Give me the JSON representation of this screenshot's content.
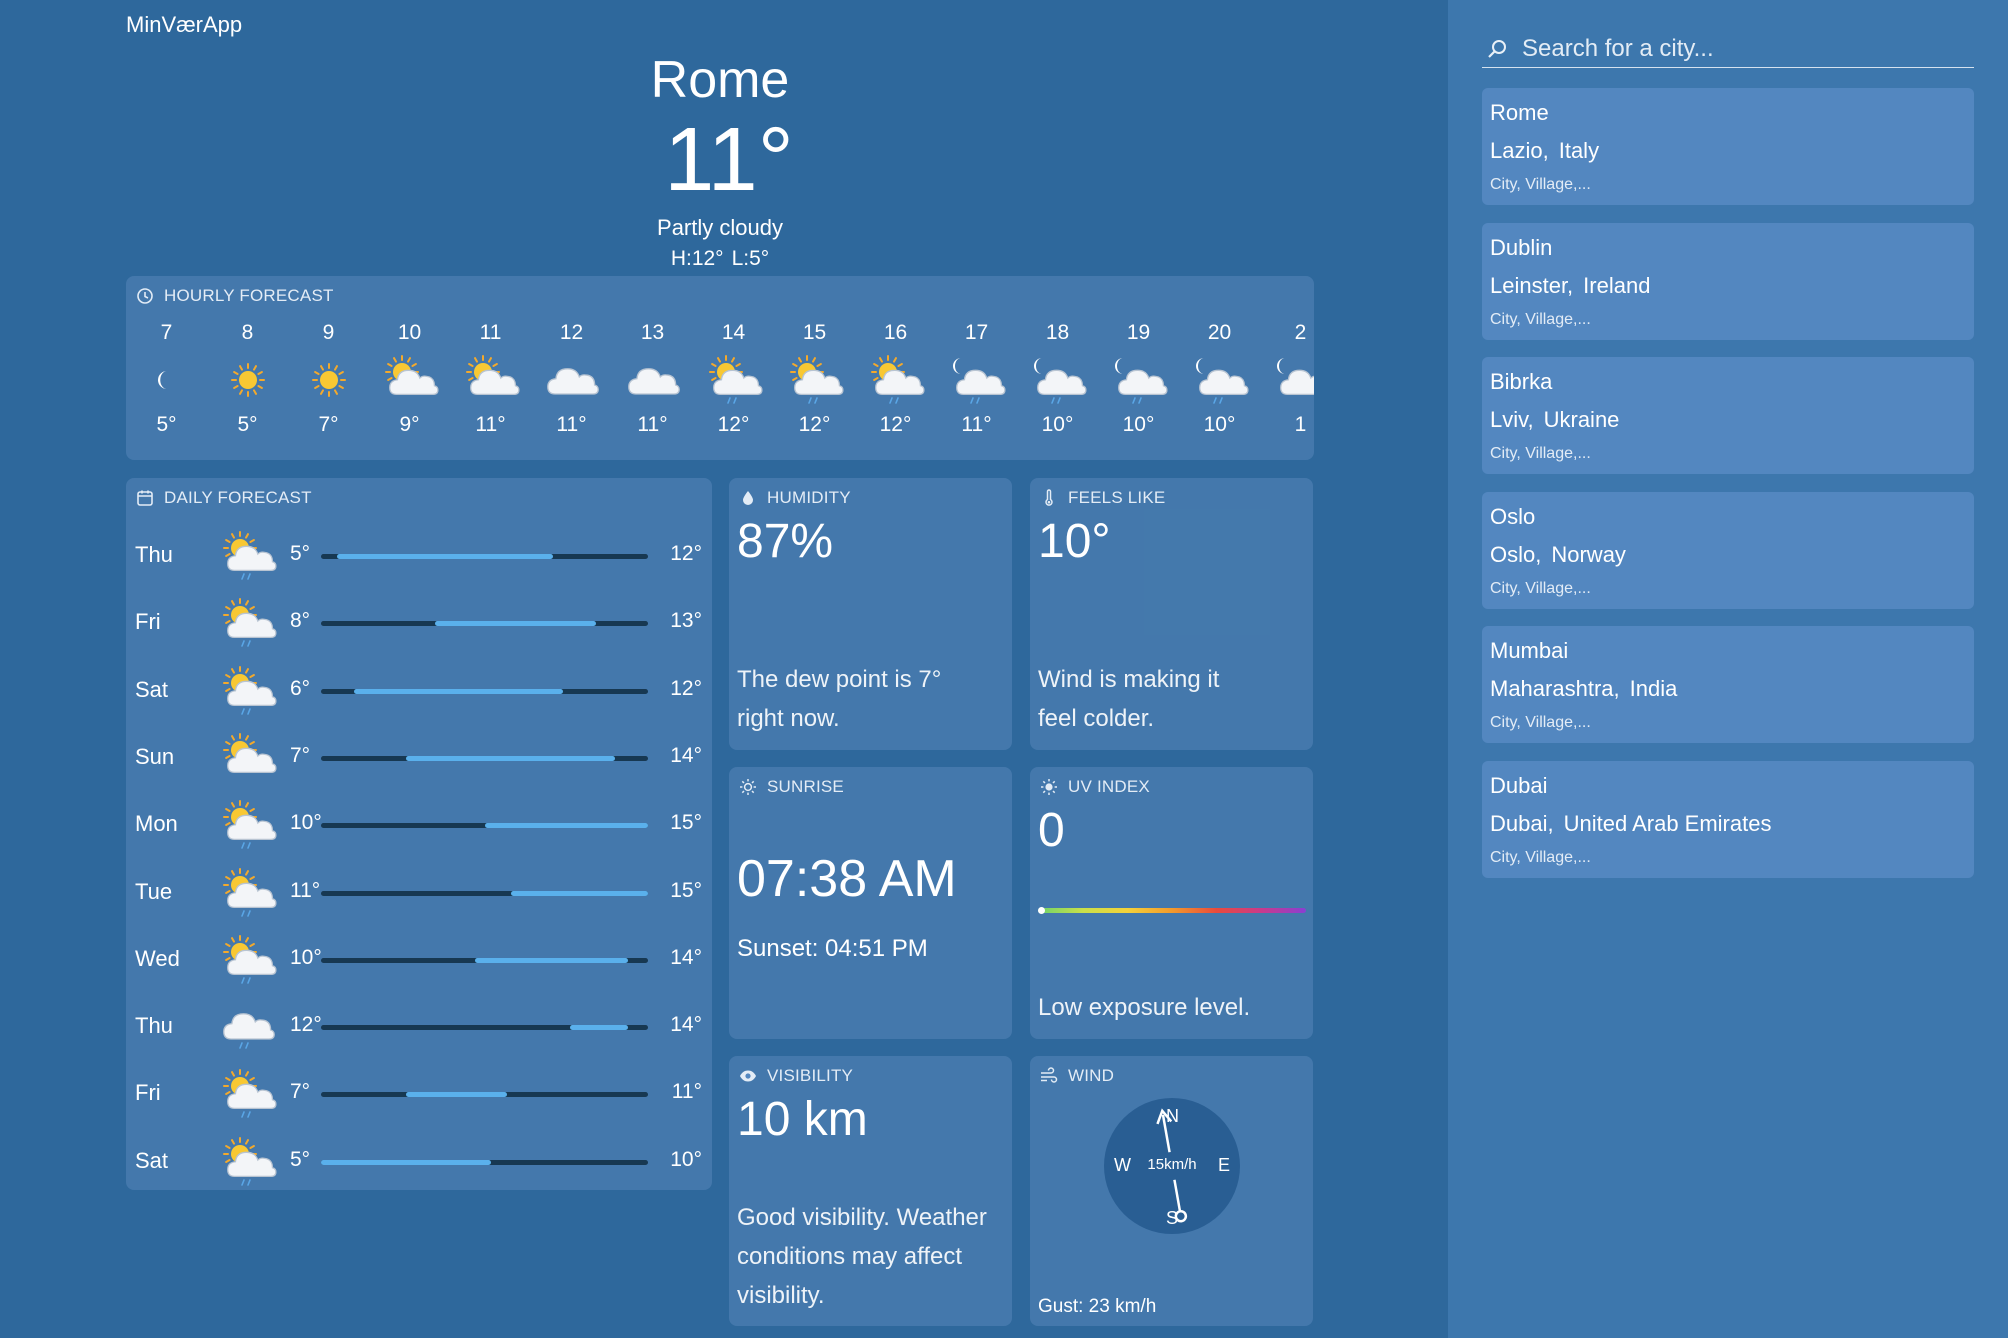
{
  "app": {
    "title": "MinVærApp"
  },
  "current": {
    "city": "Rome",
    "temp": "11°",
    "condition": "Partly cloudy",
    "high": "H:12°",
    "low": "L:5°"
  },
  "hourly": {
    "header": "HOURLY FORECAST",
    "icon": "clock-icon",
    "items": [
      {
        "hour": "7",
        "temp": "5°",
        "icon": "moon"
      },
      {
        "hour": "8",
        "temp": "5°",
        "icon": "sun"
      },
      {
        "hour": "9",
        "temp": "7°",
        "icon": "sun"
      },
      {
        "hour": "10",
        "temp": "9°",
        "icon": "sun-cloud"
      },
      {
        "hour": "11",
        "temp": "11°",
        "icon": "sun-cloud"
      },
      {
        "hour": "12",
        "temp": "11°",
        "icon": "cloud"
      },
      {
        "hour": "13",
        "temp": "11°",
        "icon": "cloud"
      },
      {
        "hour": "14",
        "temp": "12°",
        "icon": "sun-cloud-rain"
      },
      {
        "hour": "15",
        "temp": "12°",
        "icon": "sun-cloud-rain"
      },
      {
        "hour": "16",
        "temp": "12°",
        "icon": "sun-cloud-rain"
      },
      {
        "hour": "17",
        "temp": "11°",
        "icon": "moon-cloud-rain"
      },
      {
        "hour": "18",
        "temp": "10°",
        "icon": "moon-cloud-rain"
      },
      {
        "hour": "19",
        "temp": "10°",
        "icon": "moon-cloud-rain"
      },
      {
        "hour": "20",
        "temp": "10°",
        "icon": "moon-cloud-rain"
      },
      {
        "hour": "2",
        "temp": "1",
        "icon": "moon-cloud"
      }
    ]
  },
  "daily": {
    "header": "DAILY FORECAST",
    "icon": "calendar-icon",
    "range_color": "#5ab0ec",
    "track_color": "#173852",
    "items": [
      {
        "day": "Thu",
        "low": "5°",
        "high": "12°",
        "icon": "sun-cloud-rain",
        "range_start": 0.05,
        "range_end": 0.71
      },
      {
        "day": "Fri",
        "low": "8°",
        "high": "13°",
        "icon": "sun-cloud-rain",
        "range_start": 0.35,
        "range_end": 0.84
      },
      {
        "day": "Sat",
        "low": "6°",
        "high": "12°",
        "icon": "sun-cloud-rain",
        "range_start": 0.1,
        "range_end": 0.74
      },
      {
        "day": "Sun",
        "low": "7°",
        "high": "14°",
        "icon": "sun-cloud",
        "range_start": 0.26,
        "range_end": 0.9
      },
      {
        "day": "Mon",
        "low": "10°",
        "high": "15°",
        "icon": "sun-cloud-rain",
        "range_start": 0.5,
        "range_end": 1.0
      },
      {
        "day": "Tue",
        "low": "11°",
        "high": "15°",
        "icon": "sun-cloud-rain",
        "range_start": 0.58,
        "range_end": 1.0
      },
      {
        "day": "Wed",
        "low": "10°",
        "high": "14°",
        "icon": "sun-cloud-rain",
        "range_start": 0.47,
        "range_end": 0.94
      },
      {
        "day": "Thu",
        "low": "12°",
        "high": "14°",
        "icon": "cloud-rain",
        "range_start": 0.76,
        "range_end": 0.94
      },
      {
        "day": "Fri",
        "low": "7°",
        "high": "11°",
        "icon": "sun-cloud-rain",
        "range_start": 0.26,
        "range_end": 0.57
      },
      {
        "day": "Sat",
        "low": "5°",
        "high": "10°",
        "icon": "sun-cloud-rain",
        "range_start": 0.0,
        "range_end": 0.52
      }
    ]
  },
  "humidity": {
    "header": "HUMIDITY",
    "value": "87%",
    "desc1": "The dew point is 7°",
    "desc2": "right now."
  },
  "feels_like": {
    "header": "FEELS LIKE",
    "value": "10°",
    "desc1": "Wind is making it",
    "desc2": "feel colder."
  },
  "sunrise": {
    "header": "SUNRISE",
    "time": "07:38 AM",
    "sunset": "Sunset: 04:51 PM"
  },
  "uv": {
    "header": "UV INDEX",
    "value": "0",
    "level": 0,
    "desc": "Low exposure level."
  },
  "visibility": {
    "header": "VISIBILITY",
    "value": "10 km",
    "desc1": "Good visibility. Weather",
    "desc2": "conditions may affect",
    "desc3": "visibility."
  },
  "wind": {
    "header": "WIND",
    "n": "N",
    "s": "S",
    "w": "W",
    "e": "E",
    "speed": "15km/h",
    "gust": "Gust: 23 km/h",
    "direction_deg": 350
  },
  "search": {
    "placeholder": "Search for a city..."
  },
  "cities": [
    {
      "name": "Rome",
      "region": "Lazio,",
      "country": "Italy",
      "type": "City, Village,..."
    },
    {
      "name": "Dublin",
      "region": "Leinster,",
      "country": "Ireland",
      "type": "City, Village,..."
    },
    {
      "name": "Bibrka",
      "region": "Lviv,",
      "country": "Ukraine",
      "type": "City, Village,..."
    },
    {
      "name": "Oslo",
      "region": "Oslo,",
      "country": "Norway",
      "type": "City, Village,..."
    },
    {
      "name": "Mumbai",
      "region": "Maharashtra,",
      "country": "India",
      "type": "City, Village,..."
    },
    {
      "name": "Dubai",
      "region": "Dubai,",
      "country": "United Arab Emirates",
      "type": "City, Village,..."
    }
  ]
}
